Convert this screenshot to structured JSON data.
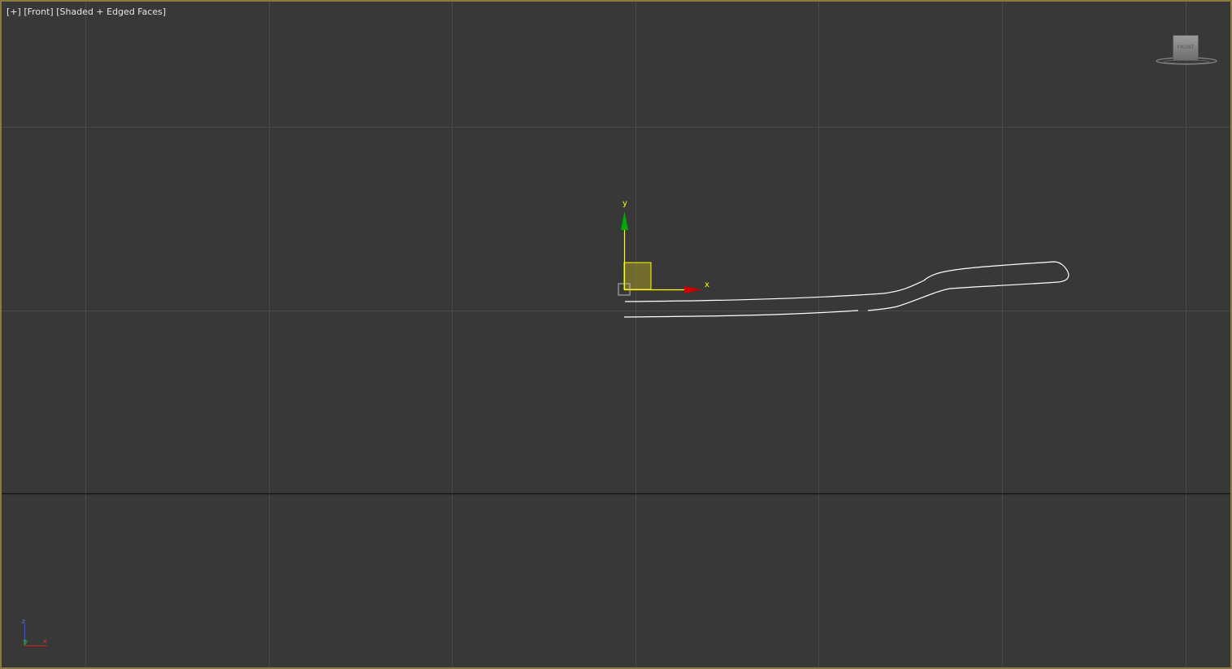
{
  "viewport": {
    "label": {
      "plus": "[+]",
      "view": "[Front]",
      "shading": "[Shaded + Edged Faces]"
    },
    "gizmo": {
      "x_axis_label": "x",
      "y_axis_label": "y"
    },
    "viewcube": {
      "face_label": "FRONT"
    },
    "axis_tripod": {
      "z_label": "z",
      "y_label": "y",
      "x_label": "x"
    },
    "colors": {
      "border": "#8c7a3e",
      "background": "#383838",
      "grid": "#4a4a4a",
      "x_axis": "#cc0000",
      "y_axis": "#00aa00",
      "gizmo": "#ffff00",
      "spline": "#ffffff"
    }
  }
}
